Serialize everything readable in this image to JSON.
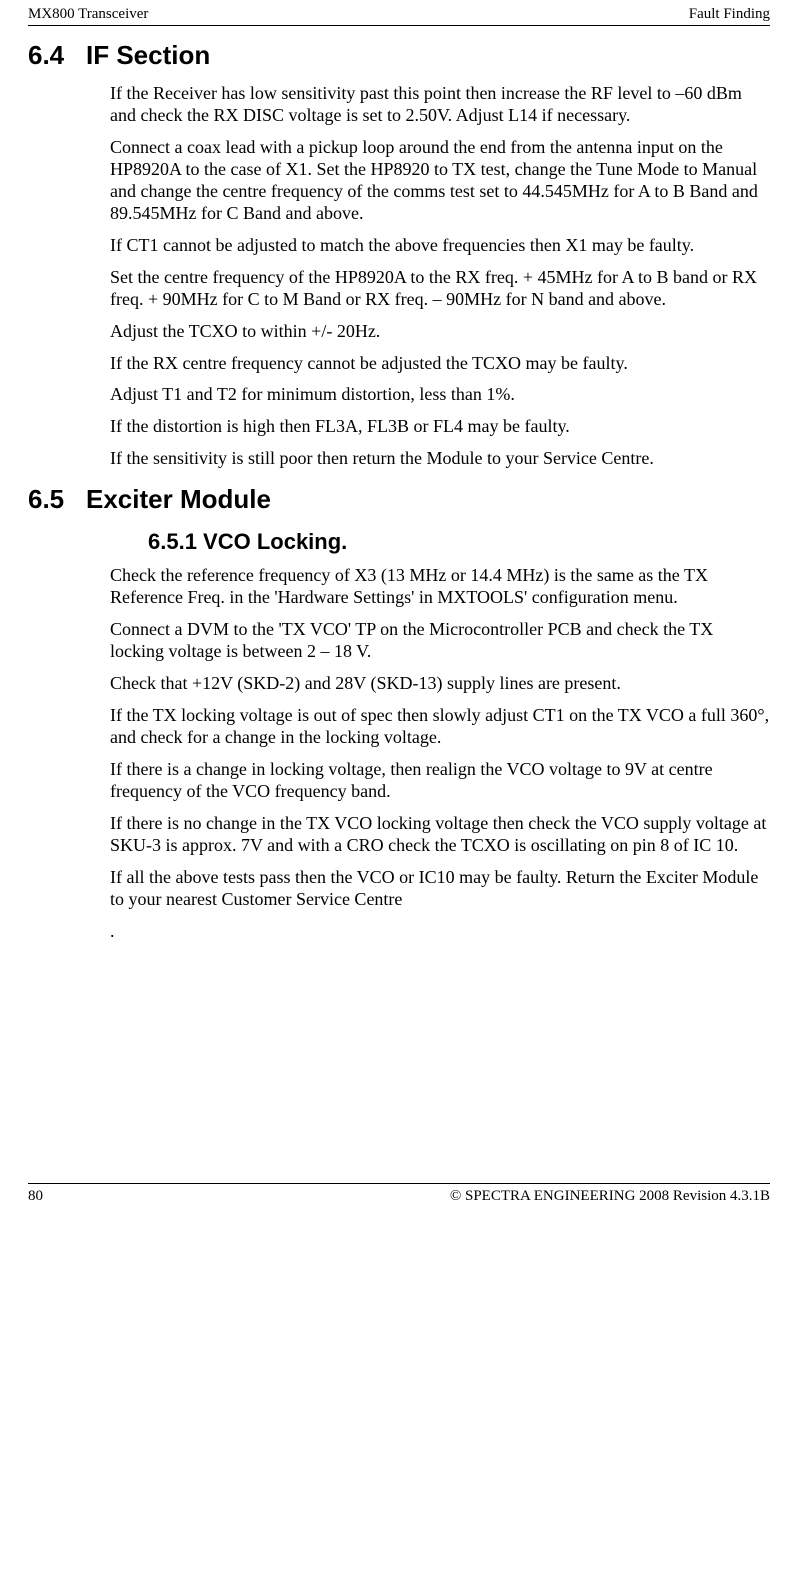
{
  "header": {
    "left": "MX800 Transceiver",
    "right": "Fault Finding"
  },
  "sections": {
    "s64": {
      "num": "6.4",
      "title": "IF Section",
      "paras": [
        "If the Receiver has low sensitivity past this point then increase the RF level to –60 dBm and check the RX DISC voltage is set to 2.50V. Adjust L14 if necessary.",
        "Connect a coax lead with a pickup loop around the end from the antenna input on the HP8920A to the case of X1. Set the HP8920 to TX test, change the Tune Mode to Manual and change the centre frequency of the comms test set to 44.545MHz for A to B Band and 89.545MHz for C Band and above.",
        "If CT1 cannot be adjusted to match the above frequencies then X1 may be faulty.",
        "Set the centre frequency of the HP8920A to the RX freq. + 45MHz for A to B band or RX freq. + 90MHz for C to M Band or RX freq. – 90MHz for N band and above.",
        "Adjust the TCXO to within +/- 20Hz.",
        "If the RX centre frequency cannot be adjusted the TCXO may be faulty.",
        "Adjust T1 and T2 for minimum distortion, less than 1%.",
        "If the distortion is high then FL3A, FL3B or FL4 may be faulty.",
        "If the sensitivity is still poor then return the Module to your Service Centre."
      ]
    },
    "s65": {
      "num": "6.5",
      "title": "Exciter Module",
      "sub651": {
        "title": "6.5.1 VCO Locking."
      },
      "paras": [
        "Check the reference frequency of X3 (13 MHz or 14.4 MHz) is the same as the TX Reference Freq. in the 'Hardware Settings' in MXTOOLS' configuration menu.",
        "Connect a DVM to the 'TX VCO' TP on the Microcontroller PCB and check the TX locking voltage is between 2 – 18 V.",
        "Check that +12V (SKD-2) and 28V (SKD-13) supply lines are present.",
        "If the TX locking voltage is out of spec then slowly adjust CT1 on the TX VCO a full 360°, and check for a change in the locking voltage.",
        "If there is a change in locking voltage, then realign the VCO voltage to 9V at centre frequency of the VCO frequency band.",
        "If there is no change in the TX VCO locking voltage then check the VCO supply voltage at SKU-3 is approx. 7V and with a CRO check the TCXO is oscillating on pin 8 of IC 10.",
        "If all the above tests pass then the VCO or IC10 may be faulty. Return the Exciter Module to your nearest Customer Service Centre",
        "."
      ]
    }
  },
  "footer": {
    "page": "80",
    "copyright": "© SPECTRA ENGINEERING 2008 Revision 4.3.1B"
  }
}
